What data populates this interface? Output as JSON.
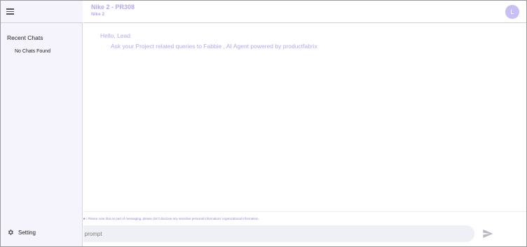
{
  "sidebar": {
    "menu_icon": "hamburger-menu-icon",
    "recent_chats_title": "Recent Chats",
    "empty_text": "No Chats Found",
    "setting_icon": "gear-icon",
    "setting_label": "Setting"
  },
  "header": {
    "project_title": "Nike 2 - PR308",
    "project_subtitle": "Nike 2",
    "avatar_initial": "L"
  },
  "chat": {
    "greeting": "Hello, Lead",
    "intro": "Ask your Project related queries to Fabbie , AI Agent powered by productfabrix"
  },
  "footer": {
    "disclaimer_prefix": "e :",
    "disclaimer_text": "Please note that as part of messaging, please don't disclose any sensitive personal information/ organizational information.",
    "prompt_placeholder": "n prompt",
    "prompt_value": "",
    "send_icon": "send-icon"
  },
  "colors": {
    "accent": "#b3a9ef",
    "sidebar_bg": "#f5f4fc",
    "input_bg": "#eff0f5",
    "avatar_bg": "#c9bff4"
  }
}
